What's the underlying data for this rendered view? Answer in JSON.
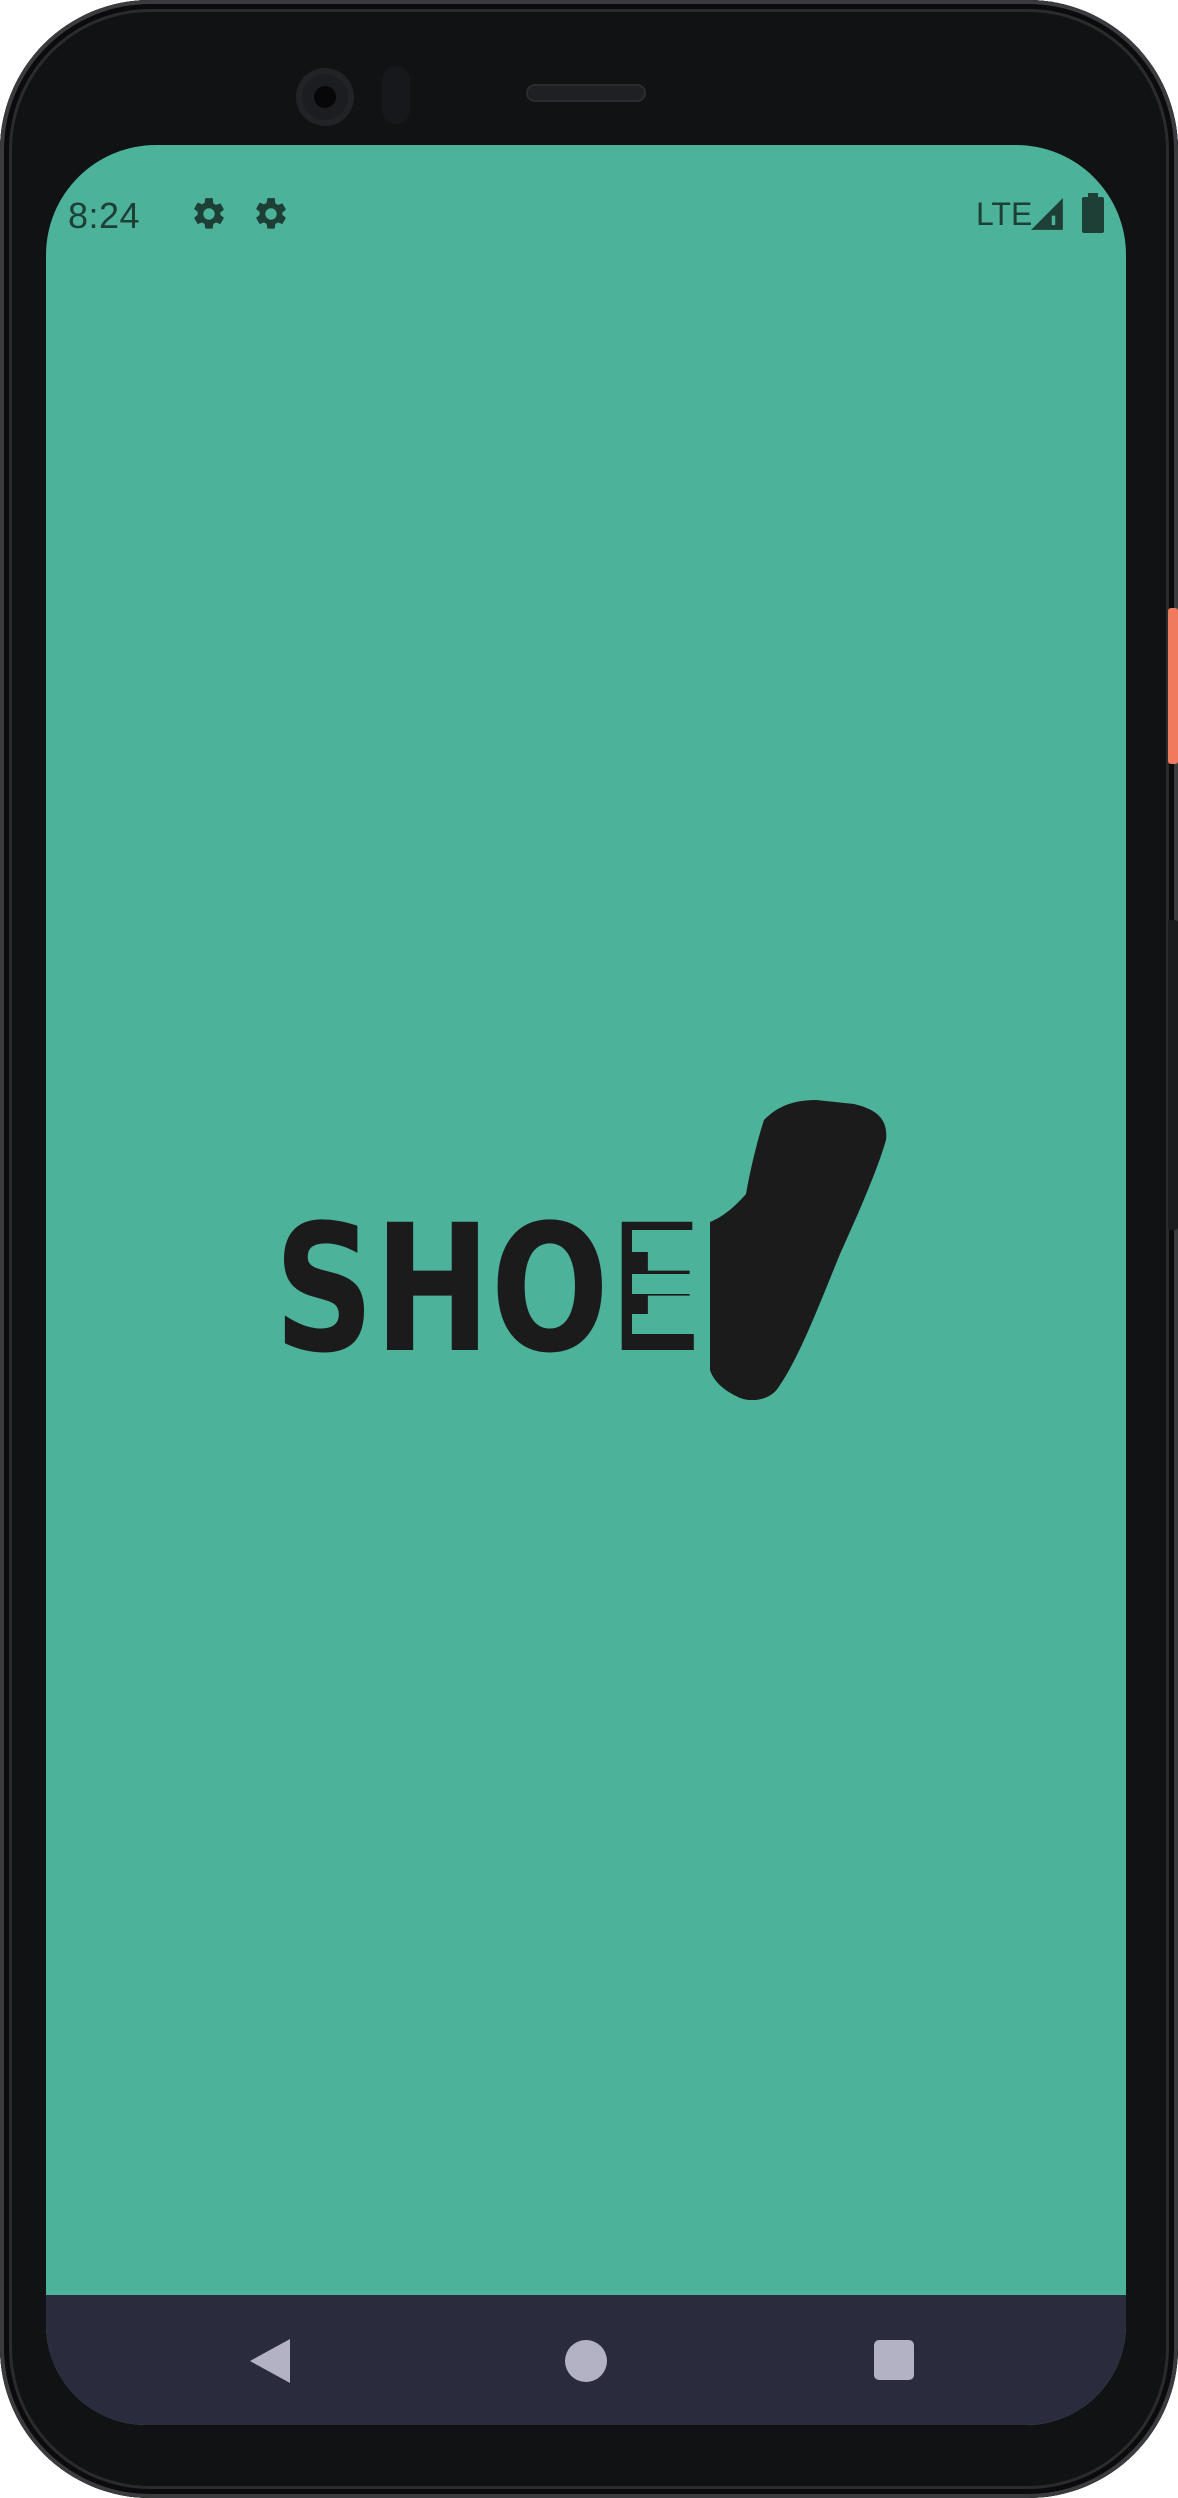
{
  "status_bar": {
    "time": "8:24",
    "network_label": "LTE",
    "icons": [
      "gear-icon",
      "gear-icon",
      "signal-icon",
      "battery-icon"
    ]
  },
  "splash": {
    "logo_text": "SHOE"
  },
  "navigation_bar": {
    "buttons": [
      "back-icon",
      "home-icon",
      "recents-icon"
    ]
  },
  "colors": {
    "screen_background": "#4cb29a",
    "status_text": "#1d3f35",
    "logo": "#1b1b1b",
    "nav_bar": "#2a2c3e",
    "nav_icons": "#b3b1c4",
    "device_body": "#111214",
    "side_button_accent": "#f07a5e"
  }
}
